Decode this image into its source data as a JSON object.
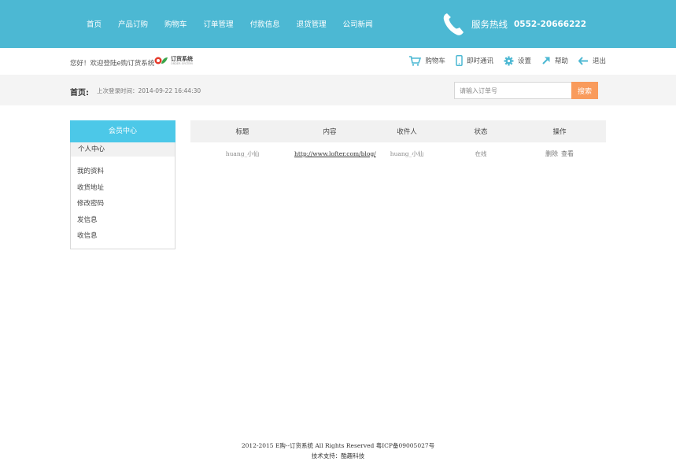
{
  "topnav": {
    "items": [
      "首页",
      "产品订购",
      "购物车",
      "订单管理",
      "付款信息",
      "退货管理",
      "公司新闻"
    ]
  },
  "hotline": {
    "label": "服务热线",
    "number": "0552-20666222",
    "icon": "phone-icon"
  },
  "userbar": {
    "welcome": "您好！欢迎登陆e购订货系统",
    "logo_text": "订货系统",
    "logo_en": "ORDER SYSTEM",
    "tools": [
      {
        "label": "购物车",
        "icon": "cart-icon"
      },
      {
        "label": "即时通讯",
        "icon": "mobile-icon"
      },
      {
        "label": "设置",
        "icon": "gear-icon"
      },
      {
        "label": "帮助",
        "icon": "help-arrow-icon"
      },
      {
        "label": "退出",
        "icon": "back-arrow-icon"
      }
    ]
  },
  "crumb": {
    "home": "首页:",
    "last_login": "上次登录时间：2014-09-22 16:44:30"
  },
  "search": {
    "placeholder": "请输入订单号",
    "button": "搜索"
  },
  "sidebar": {
    "title": "会员中心",
    "section": "个人中心",
    "items": [
      "我的资料",
      "收货地址",
      "修改密码",
      "发信息",
      "收信息"
    ]
  },
  "table": {
    "headers": [
      "标题",
      "内容",
      "收件人",
      "状态",
      "操作"
    ],
    "rows": [
      {
        "title": "huang_小仙",
        "content": "http://www.lofter.com/blog/",
        "recipient": "huang_小仙",
        "status": "在线",
        "actions": [
          "删除",
          "查看"
        ]
      }
    ]
  },
  "footer": {
    "line1": "2012-2015 E购--订货系统 All Rights Reserved 粤ICP备09005027号",
    "line2": "技术支持：酷趣科技"
  },
  "colors": {
    "header": "#4cb8d3",
    "sidebar_head": "#4cc8e8",
    "search_button": "#f99b5c"
  }
}
